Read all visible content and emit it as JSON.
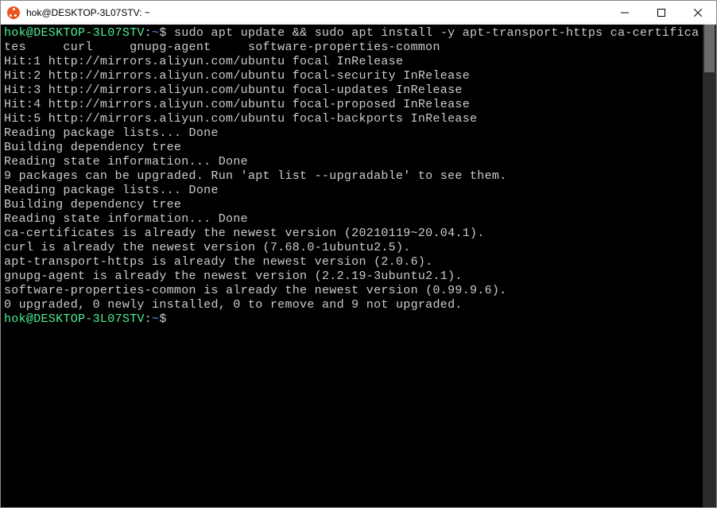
{
  "window": {
    "title": "hok@DESKTOP-3L07STV: ~"
  },
  "terminal": {
    "prompt_user": "hok@DESKTOP-3L07STV",
    "prompt_sep": ":",
    "prompt_path": "~",
    "prompt_symbol": "$",
    "command": "sudo apt update && sudo apt install -y apt-transport-https ca-certificates     curl     gnupg-agent     software-properties-common",
    "lines": [
      "Hit:1 http://mirrors.aliyun.com/ubuntu focal InRelease",
      "Hit:2 http://mirrors.aliyun.com/ubuntu focal-security InRelease",
      "Hit:3 http://mirrors.aliyun.com/ubuntu focal-updates InRelease",
      "Hit:4 http://mirrors.aliyun.com/ubuntu focal-proposed InRelease",
      "Hit:5 http://mirrors.aliyun.com/ubuntu focal-backports InRelease",
      "Reading package lists... Done",
      "Building dependency tree",
      "Reading state information... Done",
      "9 packages can be upgraded. Run 'apt list --upgradable' to see them.",
      "Reading package lists... Done",
      "Building dependency tree",
      "Reading state information... Done",
      "ca-certificates is already the newest version (20210119~20.04.1).",
      "curl is already the newest version (7.68.0-1ubuntu2.5).",
      "apt-transport-https is already the newest version (2.0.6).",
      "gnupg-agent is already the newest version (2.2.19-3ubuntu2.1).",
      "software-properties-common is already the newest version (0.99.9.6).",
      "0 upgraded, 0 newly installed, 0 to remove and 9 not upgraded."
    ]
  }
}
